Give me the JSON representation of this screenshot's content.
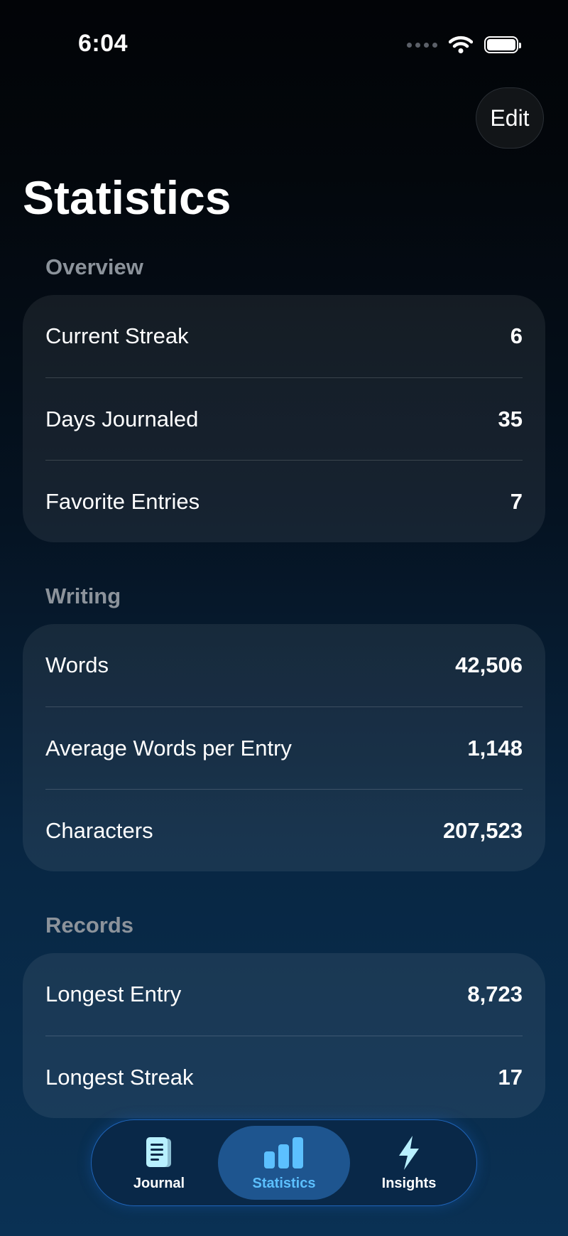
{
  "status_bar": {
    "time": "6:04"
  },
  "header": {
    "edit_label": "Edit",
    "title": "Statistics"
  },
  "sections": [
    {
      "title": "Overview",
      "rows": [
        {
          "label": "Current Streak",
          "value": "6"
        },
        {
          "label": "Days Journaled",
          "value": "35"
        },
        {
          "label": "Favorite Entries",
          "value": "7"
        }
      ]
    },
    {
      "title": "Writing",
      "rows": [
        {
          "label": "Words",
          "value": "42,506"
        },
        {
          "label": "Average Words per Entry",
          "value": "1,148"
        },
        {
          "label": "Characters",
          "value": "207,523"
        }
      ]
    },
    {
      "title": "Records",
      "rows": [
        {
          "label": "Longest Entry",
          "value": "8,723"
        },
        {
          "label": "Longest Streak",
          "value": "17"
        }
      ]
    }
  ],
  "tab_bar": {
    "tabs": [
      {
        "label": "Journal",
        "icon": "journal-icon",
        "selected": false
      },
      {
        "label": "Statistics",
        "icon": "bar-chart-icon",
        "selected": true
      },
      {
        "label": "Insights",
        "icon": "lightning-bolt-icon",
        "selected": false
      }
    ]
  },
  "colors": {
    "accent": "#5cc0ff",
    "icon_tint": "#b8f0ff",
    "section_header": "#8c939b",
    "tab_selected_bg": "#1e558f",
    "tab_bar_border": "#1f64b8"
  }
}
